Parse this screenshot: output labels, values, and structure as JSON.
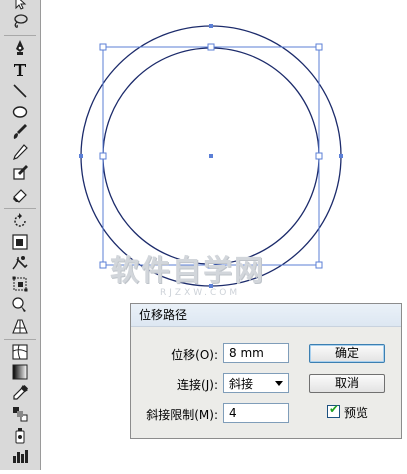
{
  "toolbar": {
    "tools": [
      "direct-selection-tool-icon",
      "lasso-tool-icon",
      "pen-tool-icon",
      "type-tool-icon",
      "line-segment-tool-icon",
      "ellipse-tool-icon",
      "paintbrush-tool-icon",
      "pencil-tool-icon",
      "blob-brush-tool-icon",
      "eraser-tool-icon",
      "rotate-tool-icon",
      "scale-tool-icon",
      "warp-tool-icon",
      "free-transform-tool-icon",
      "shape-builder-tool-icon",
      "perspective-grid-tool-icon",
      "mesh-tool-icon",
      "gradient-tool-icon",
      "eyedropper-tool-icon",
      "blend-tool-icon",
      "symbol-sprayer-tool-icon",
      "column-graph-tool-icon"
    ]
  },
  "watermark": {
    "text": "软件自学网",
    "sub": "RJZXW.COM"
  },
  "colors": {
    "path": "#1c2b6b",
    "bounding_box": "#5b7fd6",
    "anchor_fill": "#ffffff",
    "dialog_bg": "#ecece9",
    "check_green": "#21a121"
  },
  "dialog": {
    "title": "位移路径",
    "offset_label": "位移(O):",
    "offset_value": "8 mm",
    "joins_label": "连接(J):",
    "joins_value": "斜接",
    "miter_label": "斜接限制(M):",
    "miter_value": "4",
    "ok_label": "确定",
    "cancel_label": "取消",
    "preview_label": "预览",
    "preview_checked": true
  }
}
